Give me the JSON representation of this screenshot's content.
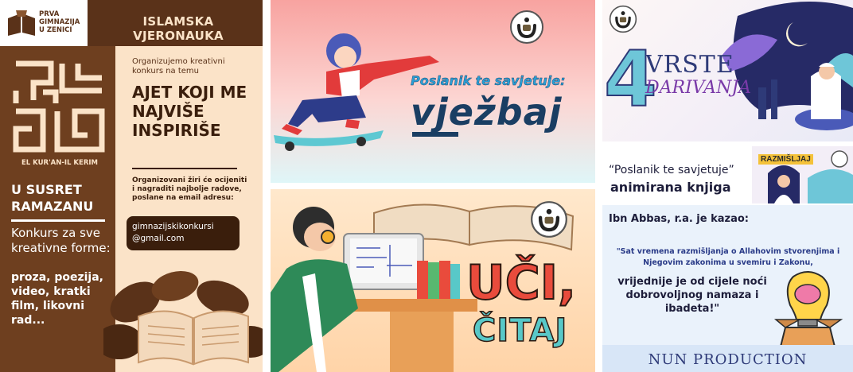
{
  "poster_left": {
    "school_name": "PRVA GIMNAZIJA U ZENICI",
    "subject": "ISLAMSKA VJERONAUKA",
    "calligraphy_caption": "EL KUR'AN-IL KERIM",
    "welcome": "U SUSRET RAMAZANU",
    "contest": "Konkurs za sve kreativne forme:",
    "forms": "proza, poezija, video, kratki film, likovni rad...",
    "intro": "Organizujemo kreativni konkurs na temu",
    "headline": "AJET KOJI ME NAJVIŠE INSPIRIŠE",
    "jury": "Organizovani žiri će ocijeniti i nagraditi najbolje radove, poslane na email adresu:",
    "email": "gimnazijskikonkursi @gmail.com",
    "colors": {
      "dark": "#5a3219",
      "cream": "#fbe3c8",
      "mid": "#8a5630"
    }
  },
  "poster_vjezbaj": {
    "subtitle": "Poslanik te savjetuje:",
    "title": "vježbaj",
    "logo": "nun-logo-icon"
  },
  "poster_uci": {
    "line1": "UČI,",
    "line2": "ČITAJ",
    "logo": "nun-logo-icon"
  },
  "poster_darivanja": {
    "number": "4",
    "word1": "VRSTE",
    "word2": "DARIVANJA",
    "logo": "nun-logo-icon"
  },
  "book_banner": {
    "caption": "“Poslanik te savjetuje”",
    "title": "animirana knjiga",
    "brand": "RAZMIŠLJAJ"
  },
  "quote_card": {
    "attribution": "Ibn Abbas, r.a. je kazao:",
    "quote_part1": "\"Sat vremena razmišljanja o Allahovim stvorenjima i Njegovim zakonima u svemiru i Zakonu,",
    "quote_part2": "vrijednije je od cijele noći dobrovoljnog namaza i ibadeta!\"",
    "footer": "NUN PRODUCTION"
  }
}
